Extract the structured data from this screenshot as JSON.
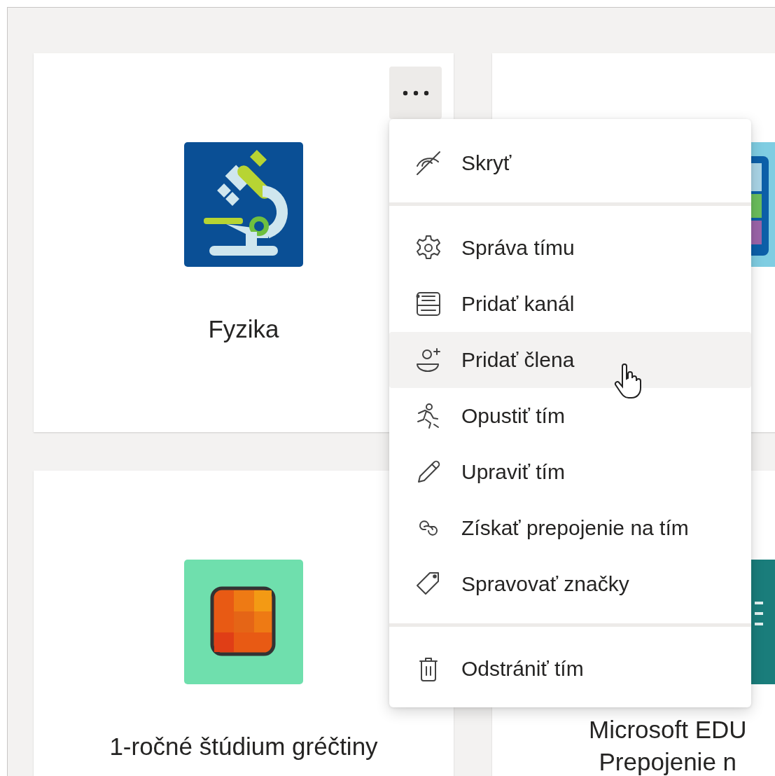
{
  "cards": [
    {
      "kind": "microscope",
      "title_lines": [
        "Fyzika"
      ]
    },
    {
      "kind": "board"
    },
    {
      "kind": "tiles",
      "title_lines": [
        "1-ročné štúdium gréčtiny"
      ]
    },
    {
      "kind": "lines",
      "title_lines": [
        "Microsoft EDU",
        "Prepojenie n"
      ]
    }
  ],
  "menu": {
    "groups": [
      {
        "items": [
          {
            "label": "Skryť",
            "highlighted": false
          }
        ]
      },
      {
        "items": [
          {
            "label": "Správa tímu",
            "highlighted": false
          },
          {
            "label": "Pridať kanál",
            "highlighted": false
          },
          {
            "label": "Pridať člena",
            "highlighted": true
          },
          {
            "label": "Opustiť tím",
            "highlighted": false
          },
          {
            "label": "Upraviť tím",
            "highlighted": false
          },
          {
            "label": "Získať prepojenie na tím",
            "highlighted": false
          },
          {
            "label": "Spravovať značky",
            "highlighted": false
          }
        ]
      },
      {
        "items": [
          {
            "label": "Odstrániť tím",
            "highlighted": false
          }
        ]
      }
    ]
  }
}
